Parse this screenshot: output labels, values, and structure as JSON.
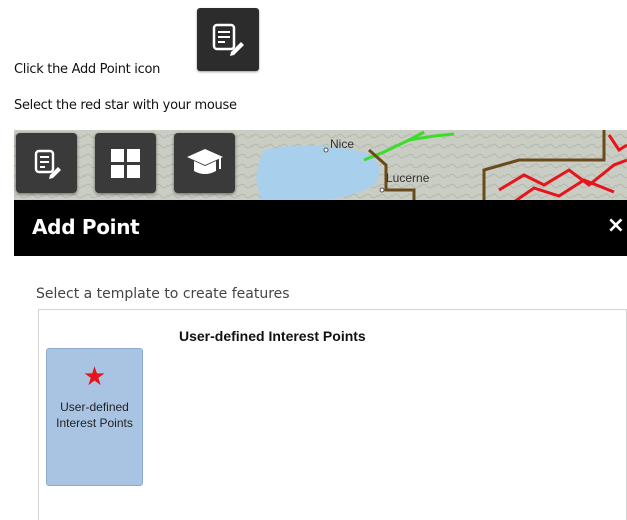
{
  "instructions": {
    "step1": "Click the Add Point icon",
    "step2": "Select the red star with your mouse"
  },
  "icons": {
    "add_point": "edit-list-icon",
    "basemap_gallery": "grid-icon",
    "layers": "graduation-cap-icon"
  },
  "map": {
    "labels": {
      "nice": "Nice",
      "lucerne": "Lucerne"
    }
  },
  "panel": {
    "title": "Add Point",
    "close_label": "×",
    "hint": "Select a template to create features",
    "group_title": "User-defined Interest Points",
    "template": {
      "label": "User-defined Interest Points",
      "icon": "red-star-icon",
      "color": "#e8141c"
    }
  },
  "colors": {
    "header_bg": "#000000",
    "tile_bg": "#a9c4e3",
    "star": "#e8141c",
    "toolbar_bg": "#3a3a3a"
  }
}
